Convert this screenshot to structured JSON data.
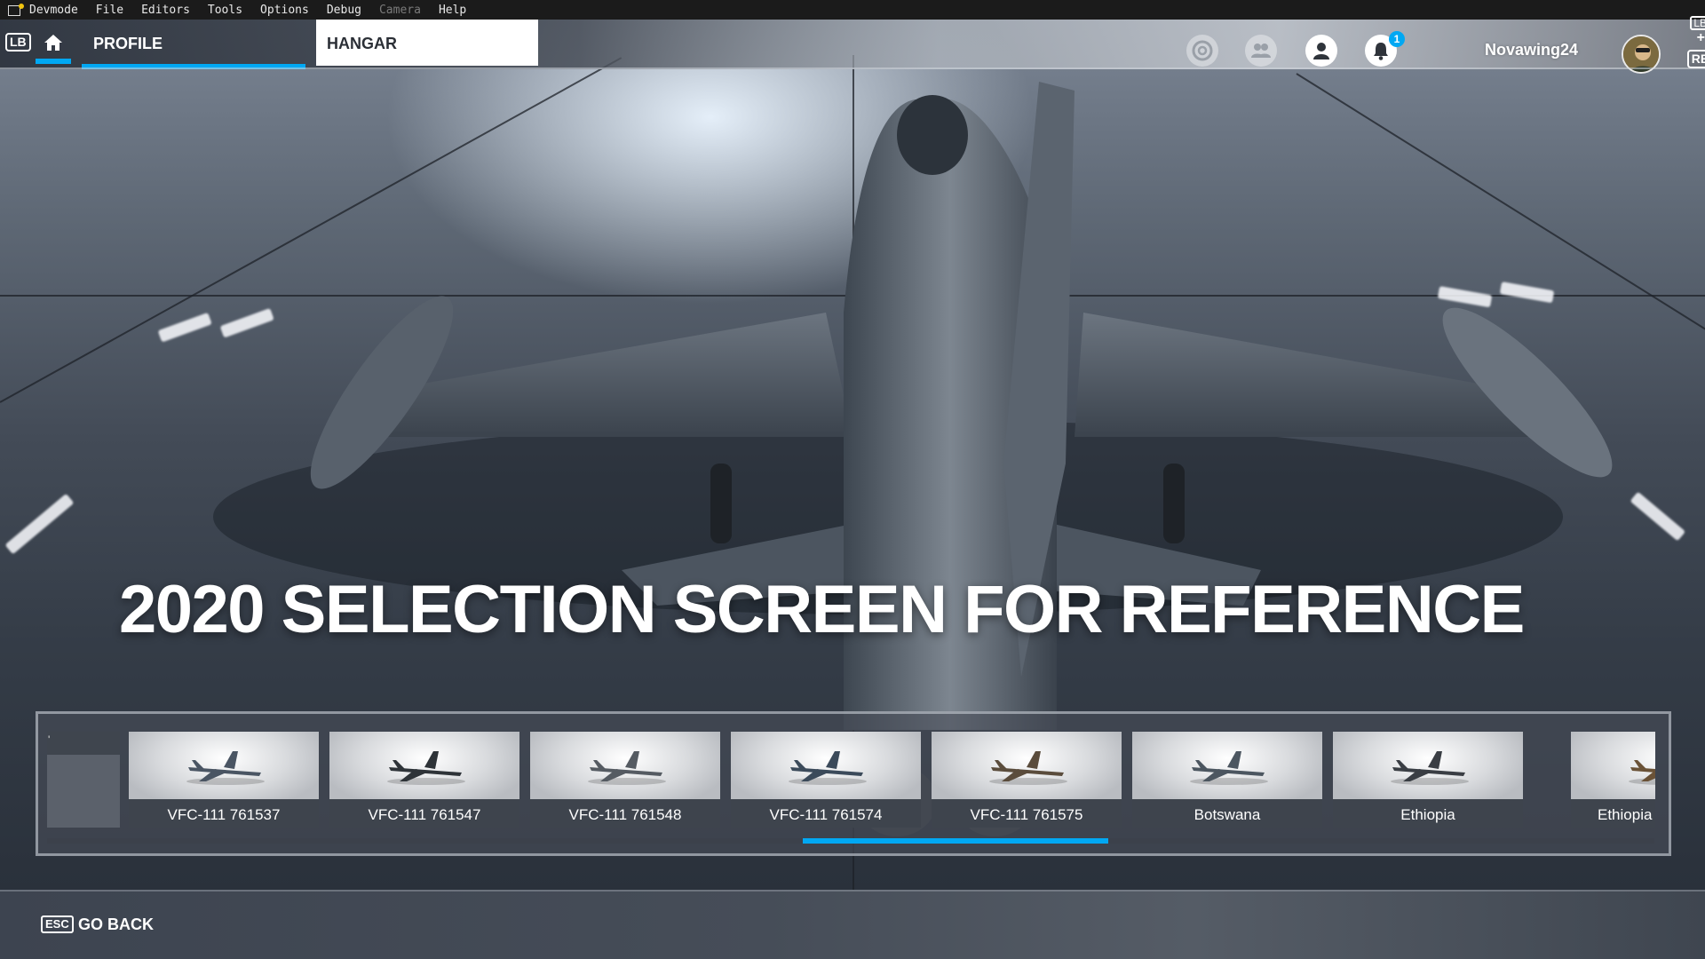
{
  "devbar": {
    "items": [
      "Devmode",
      "File",
      "Editors",
      "Tools",
      "Options",
      "Debug",
      "Camera",
      "Help"
    ]
  },
  "nav": {
    "lb_label": "LB",
    "rb_label": "RB",
    "rb_top_label": "LB",
    "plus_label": "+",
    "tabs": [
      {
        "label": "PROFILE"
      },
      {
        "label": "HANGAR"
      }
    ],
    "icons": [
      "activity-icon",
      "friends-icon",
      "profile-icon",
      "notifications-icon"
    ],
    "notification_count": "1",
    "username": "Novawing24"
  },
  "headline": "2020 SELECTION SCREEN FOR REFERENCE",
  "carousel": {
    "prev_marker": "'",
    "liveries": [
      {
        "name": "VFC-111 761537",
        "tint": "#4a5563"
      },
      {
        "name": "VFC-111 761547",
        "tint": "#2e3338"
      },
      {
        "name": "VFC-111 761548",
        "tint": "#555b62"
      },
      {
        "name": "VFC-111 761574",
        "tint": "#3b4a5a"
      },
      {
        "name": "VFC-111 761575",
        "tint": "#5a4c3c"
      },
      {
        "name": "Botswana",
        "tint": "#4c5660"
      },
      {
        "name": "Ethiopia",
        "tint": "#3a3e44"
      },
      {
        "name": "Ethiopia Cam",
        "tint": "#6a5237"
      }
    ],
    "scroll_position": 0.47,
    "scroll_fraction": 0.19
  },
  "bottom": {
    "esc_key": "ESC",
    "go_back": "GO BACK"
  },
  "colors": {
    "accent": "#00a8f3",
    "tab_active_bg": "#ffffff",
    "menu_disabled": "#7a7a7a"
  }
}
